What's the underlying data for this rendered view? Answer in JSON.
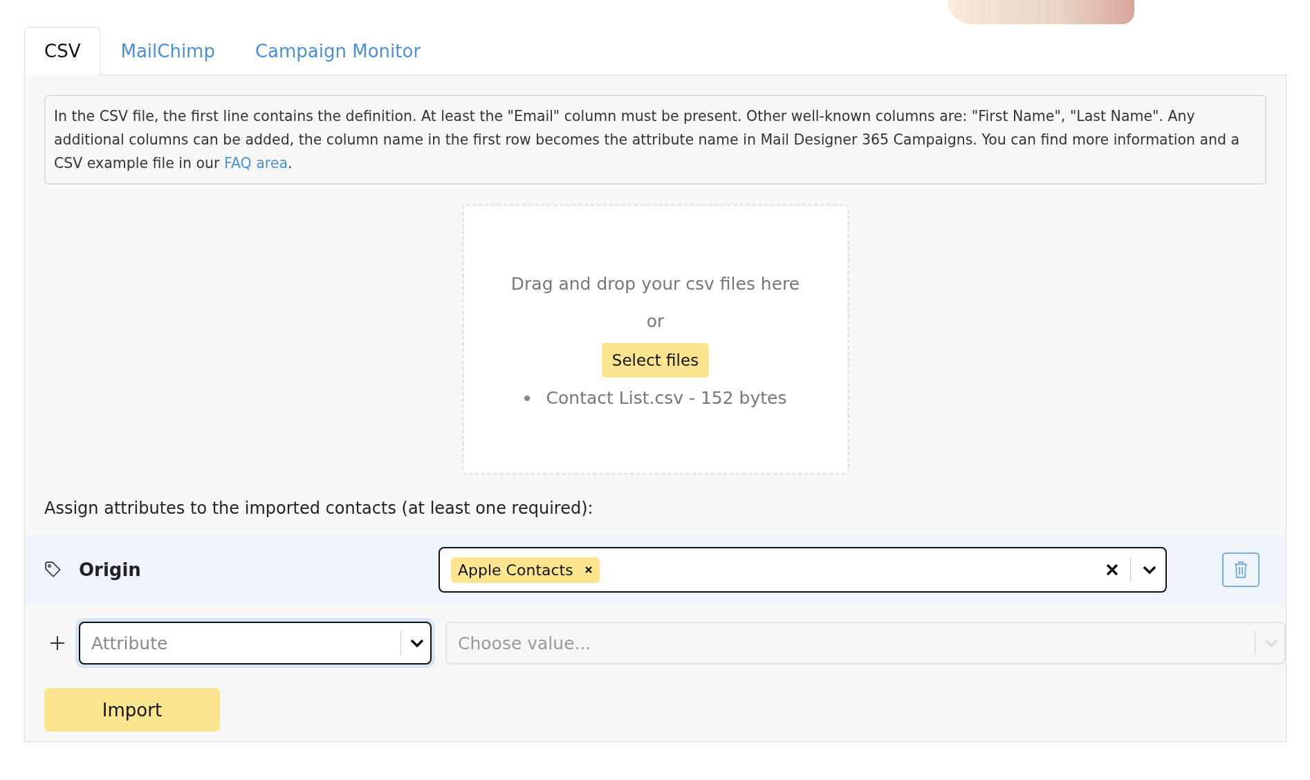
{
  "tabs": [
    {
      "label": "CSV",
      "selected": true
    },
    {
      "label": "MailChimp",
      "selected": false
    },
    {
      "label": "Campaign Monitor",
      "selected": false
    }
  ],
  "info": {
    "text": "In the CSV file, the first line contains the definition. At least the \"Email\" column must be present. Other well-known columns are: \"First Name\", \"Last Name\". Any additional columns can be added, the column name in the first row becomes the attribute name in Mail Designer 365 Campaigns. You can find more information and a CSV example file in our ",
    "link": "FAQ area",
    "after": "."
  },
  "dropzone": {
    "hint": "Drag and drop your csv files here",
    "or": "or",
    "button": "Select files",
    "files": [
      "Contact List.csv - 152 bytes"
    ]
  },
  "assign_label": "Assign attributes to the imported contacts (at least one required):",
  "attributes": [
    {
      "name": "Origin",
      "values": [
        "Apple Contacts"
      ]
    }
  ],
  "new_attribute": {
    "attribute_placeholder": "Attribute",
    "value_placeholder": "Choose value...",
    "value_disabled": true
  },
  "import_button": "Import"
}
